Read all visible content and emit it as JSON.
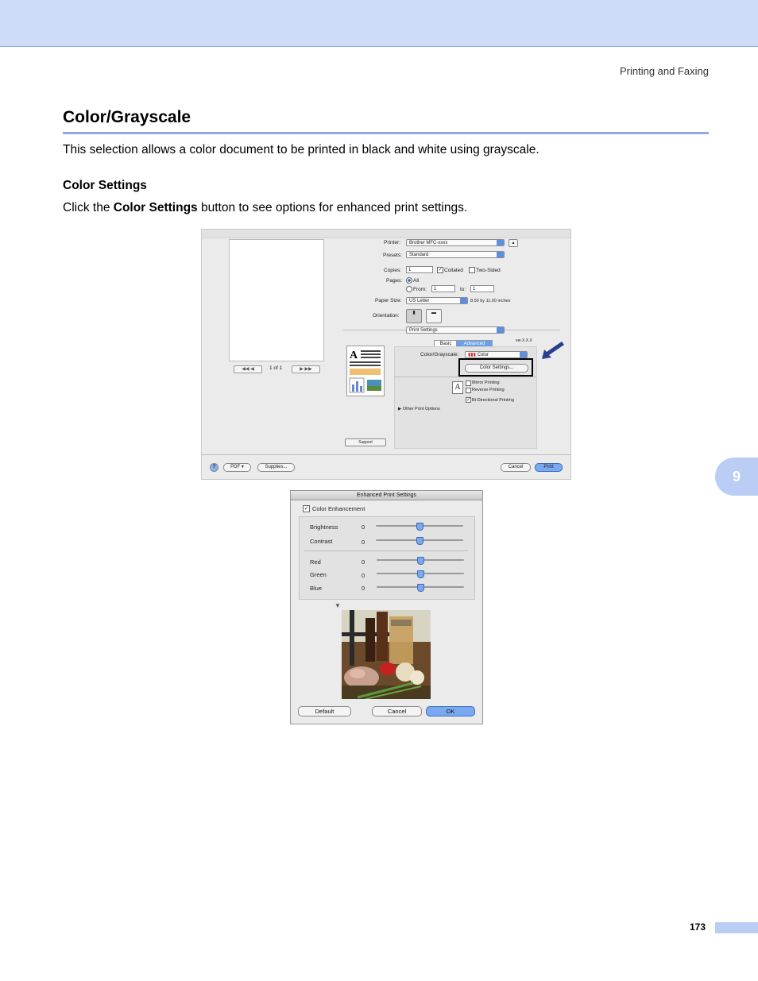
{
  "header": {
    "section": "Printing and Faxing"
  },
  "title": "Color/Grayscale",
  "intro": "This selection allows a color document to be printed in black and white using grayscale.",
  "subheading": "Color Settings",
  "instruction": {
    "pre": "Click the ",
    "bold": "Color Settings",
    "post": " button to see options for enhanced print settings."
  },
  "chapter_tab": "9",
  "page_number": "173",
  "print_dialog": {
    "page_indicator": "1 of 1",
    "printer_label": "Printer:",
    "printer_value": "Brother MFC-xxxx",
    "presets_label": "Presets:",
    "presets_value": "Standard",
    "copies_label": "Copies:",
    "copies_value": "1",
    "collated_label": "Collated",
    "two_sided_label": "Two-Sided",
    "pages_label": "Pages:",
    "all_label": "All",
    "from_label": "From:",
    "from_value": "1",
    "to_label": "to:",
    "to_value": "1",
    "paper_size_label": "Paper Size:",
    "paper_size_value": "US Letter",
    "paper_size_note": "8.50 by 11.00 inches",
    "orientation_label": "Orientation:",
    "section_popup": "Print Settings",
    "tab_basic": "Basic",
    "tab_advanced": "Advanced",
    "version": "ver.X.X.X",
    "color_grayscale_label": "Color/Grayscale:",
    "color_grayscale_value": "Color",
    "color_settings_button": "Color Settings...",
    "mirror_printing": "Mirror Printing",
    "reverse_printing": "Reverse Printing",
    "bidirectional_printing": "Bi-Directional Printing",
    "other_print_options": "Other Print Options",
    "support_button": "Support",
    "help_icon": "?",
    "pdf_button": "PDF ▾",
    "supplies_button": "Supplies...",
    "cancel_button": "Cancel",
    "print_button": "Print"
  },
  "enhanced_dialog": {
    "title": "Enhanced Print Settings",
    "color_enhancement": "Color Enhancement",
    "sliders": [
      {
        "label": "Brightness",
        "value": "0"
      },
      {
        "label": "Contrast",
        "value": "0"
      },
      {
        "label": "Red",
        "value": "0"
      },
      {
        "label": "Green",
        "value": "0"
      },
      {
        "label": "Blue",
        "value": "0"
      }
    ],
    "default_button": "Default",
    "cancel_button": "Cancel",
    "ok_button": "OK"
  }
}
